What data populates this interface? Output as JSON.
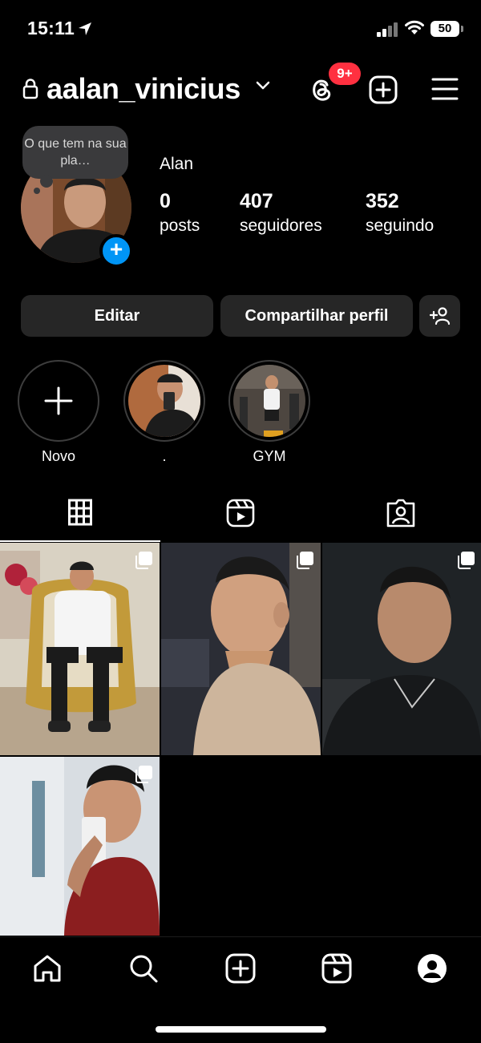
{
  "status_bar": {
    "time": "15:11",
    "battery": "50"
  },
  "header": {
    "username": "aalan_vinicius",
    "notification_badge": "9+",
    "icons": [
      "lock-icon",
      "chevron-down-icon",
      "threads-icon",
      "create-icon",
      "menu-icon"
    ]
  },
  "profile": {
    "note": "O que tem na sua pla…",
    "name": "Alan",
    "stats": [
      {
        "value": "0",
        "label": "posts"
      },
      {
        "value": "407",
        "label": "seguidores"
      },
      {
        "value": "352",
        "label": "seguindo"
      }
    ]
  },
  "actions": {
    "edit": "Editar",
    "share": "Compartilhar perfil"
  },
  "highlights": [
    {
      "label": "Novo"
    },
    {
      "label": "."
    },
    {
      "label": "GYM"
    }
  ],
  "tabs": [
    "grid-icon",
    "reels-icon",
    "tagged-icon"
  ],
  "nav": [
    "home-icon",
    "search-icon",
    "create-icon",
    "reels-icon",
    "profile-icon"
  ],
  "colors": {
    "accent": "#0095f6",
    "badge": "#ff3040",
    "button_bg": "#262626"
  }
}
